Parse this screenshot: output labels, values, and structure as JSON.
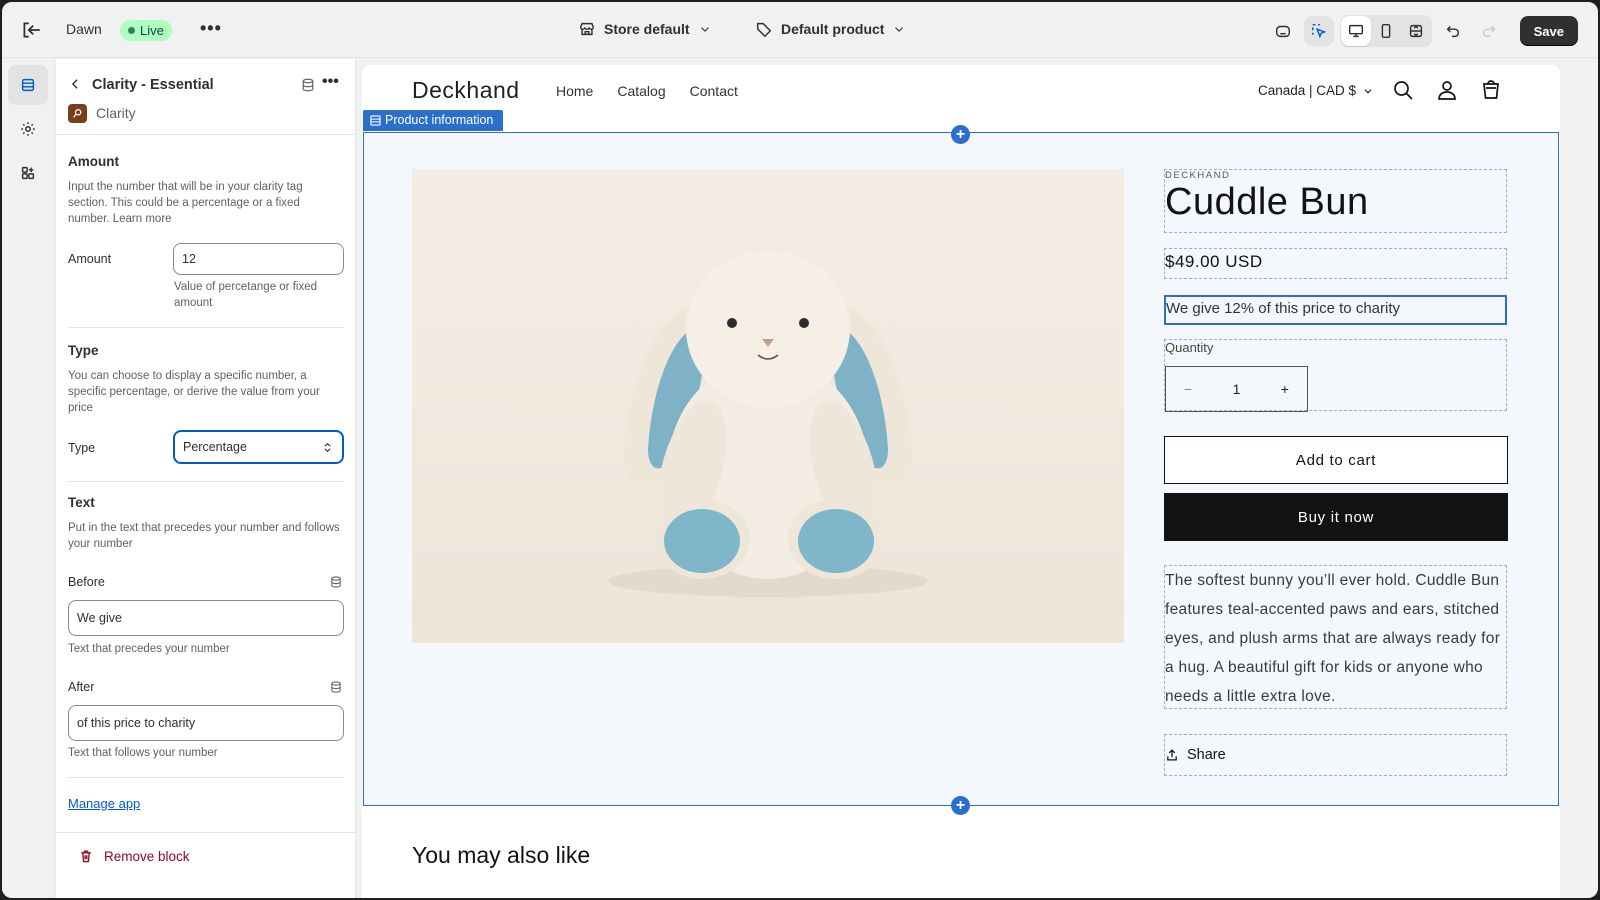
{
  "topbar": {
    "theme_name": "Dawn",
    "status": "Live",
    "more": "•••",
    "store_context": "Store default",
    "product_context": "Default product",
    "save_label": "Save"
  },
  "panel": {
    "title": "Clarity - Essential",
    "app_name": "Clarity",
    "more": "•••",
    "amount_section": {
      "heading": "Amount",
      "description": "Input the number that will be in your clarity tag section. This could be a percentage or a fixed number. Learn more",
      "field_label": "Amount",
      "field_value": "12",
      "field_hint": "Value of percetange or fixed amount"
    },
    "type_section": {
      "heading": "Type",
      "description": "You can choose to display a specific number, a specific percentage, or derive the value from your price",
      "field_label": "Type",
      "selected": "Percentage"
    },
    "text_section": {
      "heading": "Text",
      "description": "Put in the text that precedes your number and follows your number",
      "before_label": "Before",
      "before_value": "We give",
      "before_hint": "Text that precedes your number",
      "after_label": "After",
      "after_value": "of this price to charity",
      "after_hint": "Text that follows your number"
    },
    "manage_app": "Manage app",
    "remove_block": "Remove block"
  },
  "store": {
    "logo": "Deckhand",
    "nav": [
      "Home",
      "Catalog",
      "Contact"
    ],
    "locale": "Canada | CAD $",
    "section_tag": "Product information",
    "vendor": "DECKHAND",
    "product_title": "Cuddle Bun",
    "price": "$49.00 USD",
    "charity_text": "We give 12% of this price to charity",
    "quantity_label": "Quantity",
    "quantity_value": "1",
    "qty_minus": "−",
    "qty_plus": "+",
    "add_to_cart": "Add to cart",
    "buy_now": "Buy it now",
    "description": "The softest bunny you’ll ever hold. Cuddle Bun features teal-accented paws and ears, stitched eyes, and plush arms that are always ready for a hug. A beautiful gift for kids or anyone who needs a little extra love.",
    "share": "Share",
    "also_like": "You may also like"
  },
  "colors": {
    "accent": "#2c6ecb",
    "live_badge": "#affebf",
    "danger": "#8e0b21",
    "button_dark": "#121212"
  }
}
